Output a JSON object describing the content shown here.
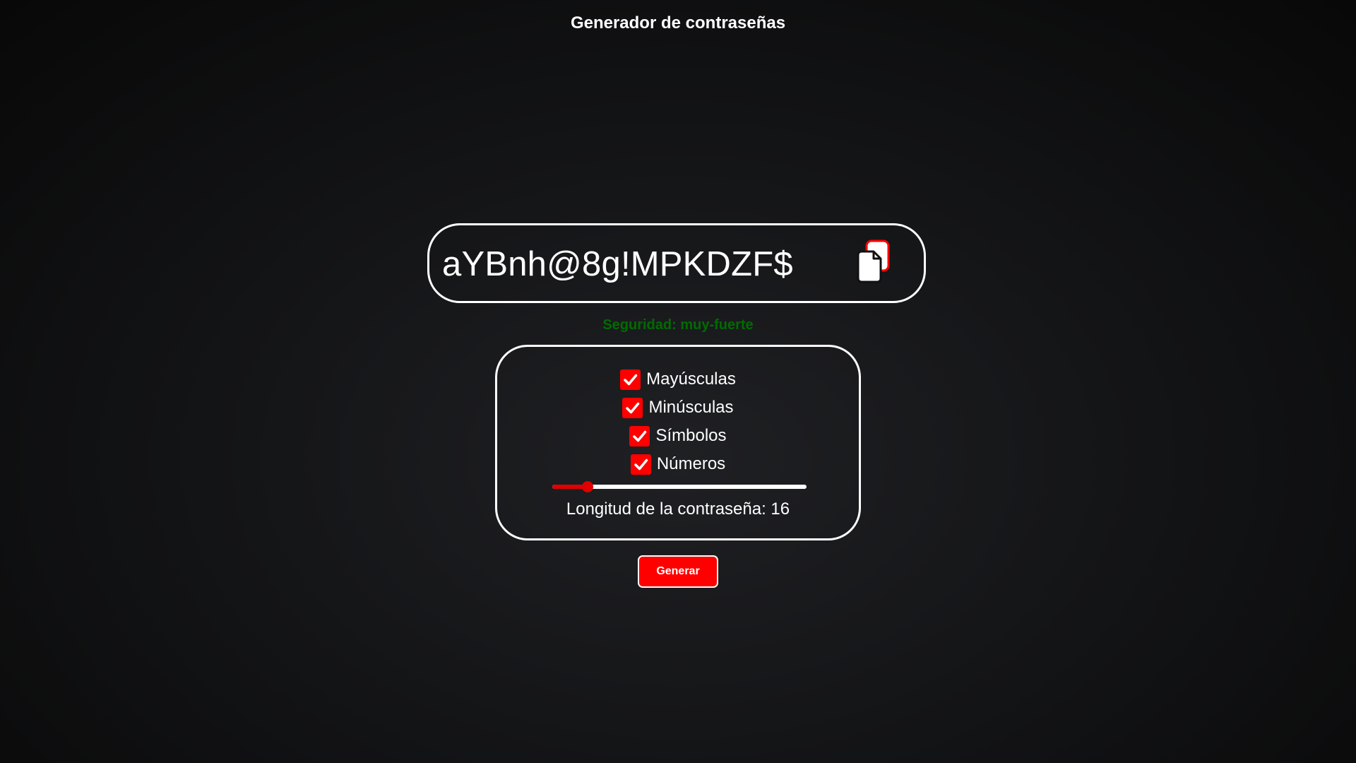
{
  "page": {
    "title": "Generador de contraseñas"
  },
  "password": {
    "value": "aYBnh@8g!MPKDZF$",
    "copy_icon": "copy-icon"
  },
  "strength": {
    "text": "Seguridad: muy-fuerte",
    "color": "#006b00"
  },
  "options": [
    {
      "label": "Mayúsculas",
      "checked": true
    },
    {
      "label": "Minúsculas",
      "checked": true
    },
    {
      "label": "Símbolos",
      "checked": true
    },
    {
      "label": "Números",
      "checked": true
    }
  ],
  "length": {
    "label": "Longitud de la contraseña: 16",
    "value": 16,
    "slider_fraction": 0.14
  },
  "actions": {
    "generate_label": "Generar"
  },
  "colors": {
    "accent": "#ff0000",
    "background": "#141517",
    "text": "#ffffff"
  }
}
